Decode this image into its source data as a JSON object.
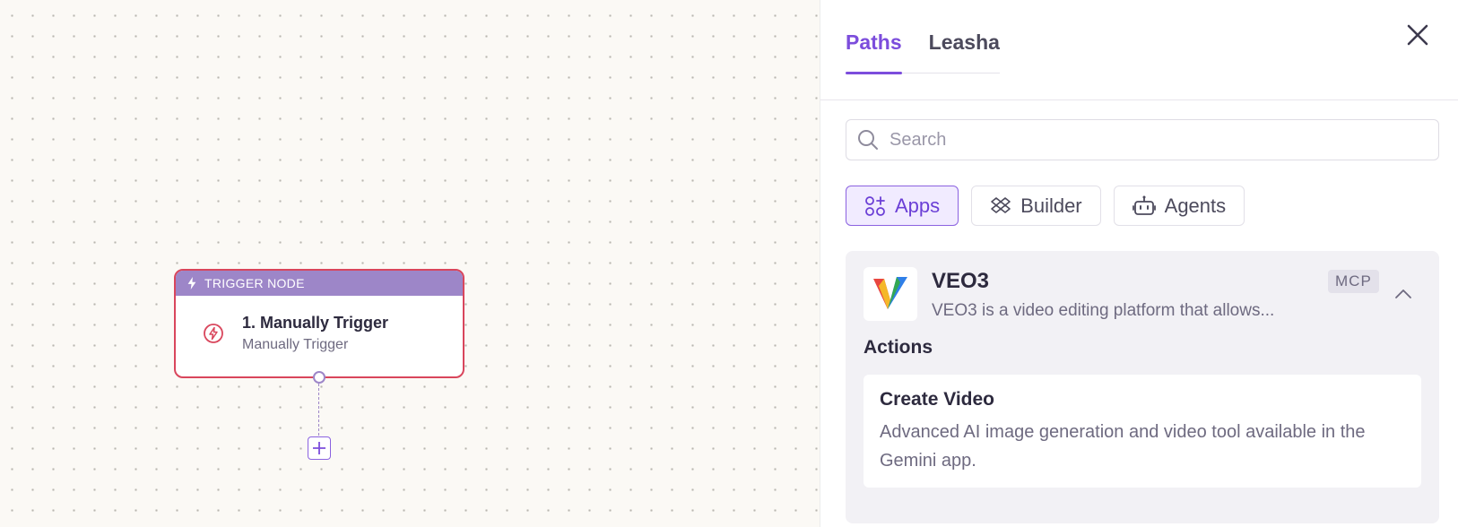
{
  "canvas": {
    "trigger_node": {
      "header": "TRIGGER NODE",
      "title": "1. Manually Trigger",
      "subtitle": "Manually Trigger"
    }
  },
  "panel": {
    "tabs": [
      {
        "label": "Paths",
        "active": true
      },
      {
        "label": "Leasha",
        "active": false
      }
    ],
    "search": {
      "placeholder": "Search",
      "value": ""
    },
    "filters": [
      {
        "label": "Apps",
        "icon": "apps-icon",
        "active": true
      },
      {
        "label": "Builder",
        "icon": "builder-icon",
        "active": false
      },
      {
        "label": "Agents",
        "icon": "robot-icon",
        "active": false
      }
    ],
    "app": {
      "name": "VEO3",
      "description": "VEO3 is a video editing platform that allows...",
      "badge": "MCP",
      "actions_heading": "Actions",
      "actions": [
        {
          "title": "Create Video",
          "description": "Advanced AI image generation and video tool available in the Gemini app."
        }
      ]
    }
  },
  "colors": {
    "accent": "#7c4ddc",
    "trigger_border": "#d9465c",
    "trigger_header": "#9d86c8"
  }
}
